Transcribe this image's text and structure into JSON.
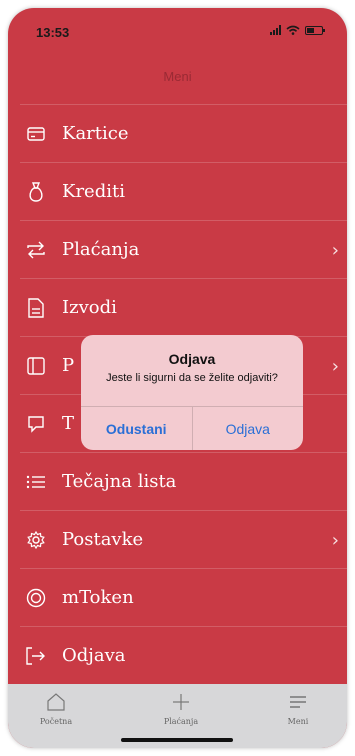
{
  "status_bar": {
    "time": "13:53"
  },
  "header": {
    "title": "Meni"
  },
  "menu": {
    "items": [
      {
        "label": "Kartice",
        "icon": "card-icon",
        "has_chevron": false
      },
      {
        "label": "Krediti",
        "icon": "money-bag-icon",
        "has_chevron": false
      },
      {
        "label": "Plaćanja",
        "icon": "transfer-arrows-icon",
        "has_chevron": true
      },
      {
        "label": "Izvodi",
        "icon": "document-icon",
        "has_chevron": false
      },
      {
        "label": "P",
        "icon": "panel-icon",
        "has_chevron": true
      },
      {
        "label": "T",
        "icon": "chat-icon",
        "has_chevron": false
      },
      {
        "label": "Tečajna lista",
        "icon": "list-icon",
        "has_chevron": false
      },
      {
        "label": "Postavke",
        "icon": "gear-icon",
        "has_chevron": true
      },
      {
        "label": "mToken",
        "icon": "token-icon",
        "has_chevron": false
      },
      {
        "label": "Odjava",
        "icon": "logout-icon",
        "has_chevron": false
      }
    ],
    "chevron": "›"
  },
  "alert": {
    "title": "Odjava",
    "message": "Jeste li sigurni da se želite odjaviti?",
    "cancel_label": "Odustani",
    "confirm_label": "Odjava"
  },
  "tab_bar": {
    "tabs": [
      {
        "label": "Početna",
        "icon": "home-icon"
      },
      {
        "label": "Plaćanja",
        "icon": "plus-icon"
      },
      {
        "label": "Meni",
        "icon": "menu-icon"
      }
    ]
  },
  "colors": {
    "background": "#c93a45",
    "alert_background": "#f3cbd0",
    "alert_button": "#2a6fd6",
    "tab_bar": "#d7d7d9"
  }
}
